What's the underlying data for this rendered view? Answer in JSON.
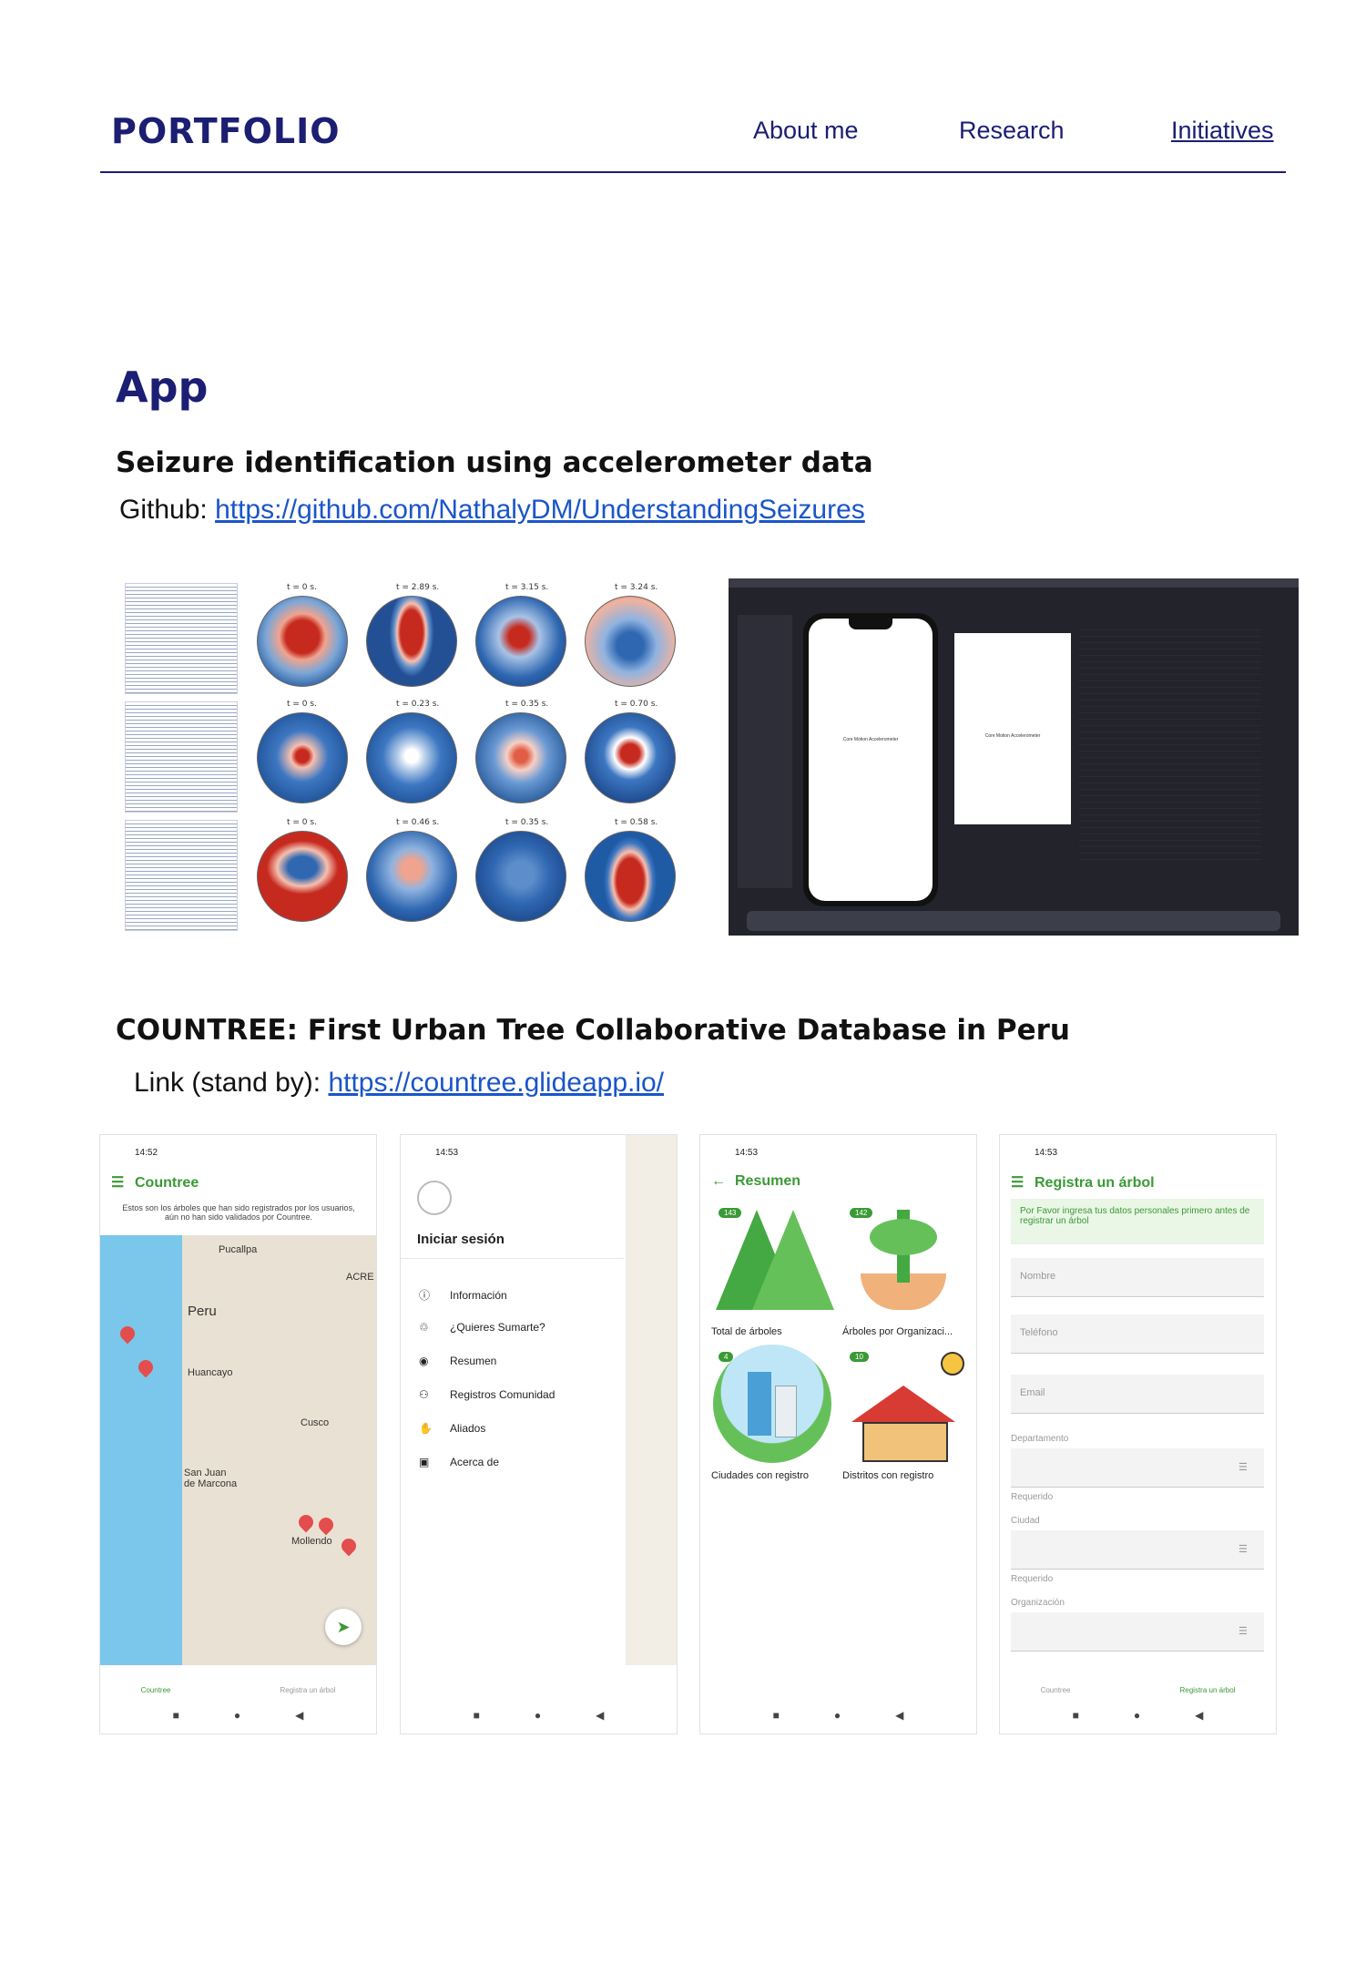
{
  "header": {
    "brand": "PORTFOLIO",
    "nav": [
      "About me",
      "Research",
      "Initiatives"
    ],
    "active": "Initiatives"
  },
  "section": {
    "title": "App",
    "project1": {
      "title": "Seizure identification using accelerometer data",
      "link_label": "Github:",
      "link_url": "https://github.com/NathalyDM/UnderstandingSeizures",
      "eeg_times": [
        [
          "t = 0 s.",
          "t = 2.89 s.",
          "t = 3.15 s.",
          "t = 3.24 s."
        ],
        [
          "t = 0 s.",
          "t = 0.23 s.",
          "t = 0.35 s.",
          "t = 0.70 s."
        ],
        [
          "t = 0 s.",
          "t = 0.46 s.",
          "t = 0.35 s.",
          "t = 0.58 s."
        ]
      ],
      "simulator_text": "Core Motion Accelerometer"
    },
    "project2": {
      "title": "COUNTREE: First Urban Tree Collaborative Database in Peru",
      "link_label": "Link (stand by):",
      "link_url": "https://countree.glideapp.io/",
      "screens": {
        "map": {
          "time": "14:52",
          "title": "Countree",
          "subtitle": "Estos son los árboles que han sido registrados por los usuarios, aún no han sido validados por Countree.",
          "places": [
            "Peru",
            "Huancayo",
            "Cusco",
            "San Juan de Marcona",
            "Mollendo",
            "ACRE",
            "Pucallpa"
          ],
          "tabs": [
            "Countree",
            "Registra un árbol"
          ]
        },
        "menu": {
          "time": "14:53",
          "login": "Iniciar sesión",
          "items": [
            "Información",
            "¿Quieres Sumarte?",
            "Resumen",
            "Registros Comunidad",
            "Aliados",
            "Acerca de"
          ]
        },
        "summary": {
          "time": "14:53",
          "title": "Resumen",
          "cards": [
            {
              "label": "Total de árboles",
              "count": "143"
            },
            {
              "label": "Árboles por Organizaci...",
              "count": "142"
            },
            {
              "label": "Ciudades con registro",
              "count": "4"
            },
            {
              "label": "Distritos con registro",
              "count": "10"
            }
          ]
        },
        "register": {
          "time": "14:53",
          "title": "Registra un árbol",
          "notice": "Por Favor ingresa tus datos personales primero antes de registrar un árbol",
          "fields": [
            "Nombre",
            "Teléfono",
            "Email"
          ],
          "selects": [
            "Departamento",
            "Ciudad",
            "Organización"
          ],
          "required": "Requerido",
          "tabs": [
            "Countree",
            "Registra un árbol"
          ]
        }
      }
    }
  },
  "colors": {
    "brand": "#1b1e72",
    "link": "#1a55c9",
    "app_green": "#3a9a35",
    "pin_red": "#e44d4d"
  }
}
